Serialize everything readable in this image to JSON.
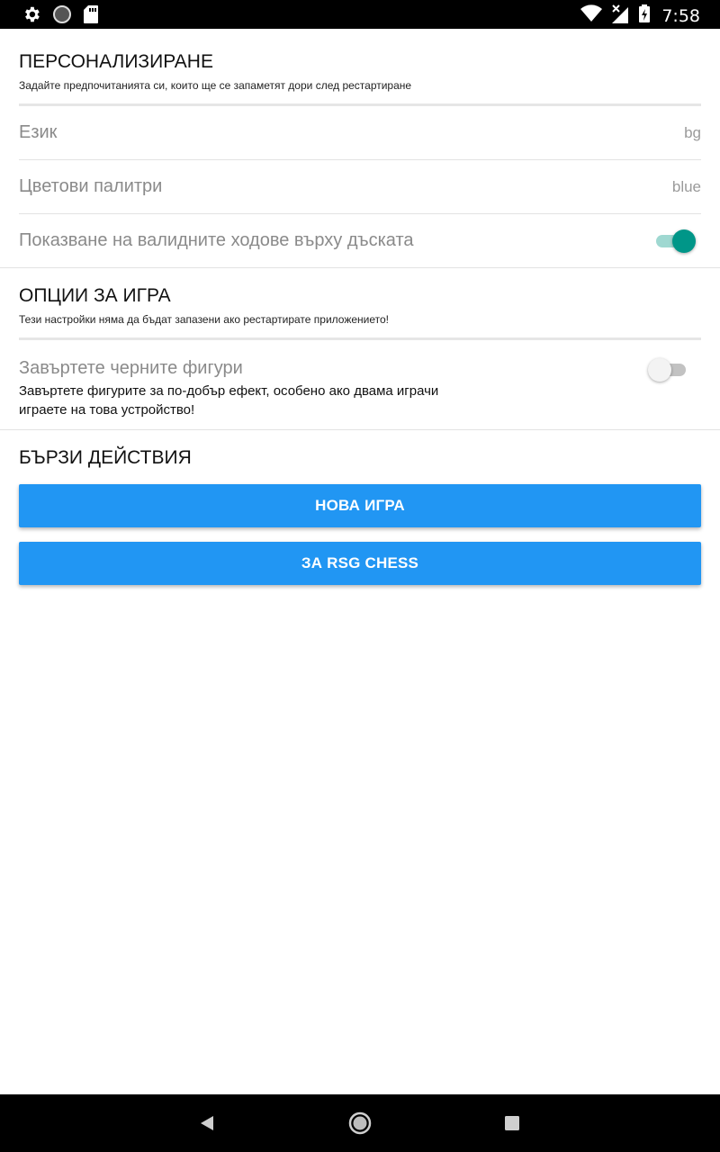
{
  "status_bar": {
    "time": "7:58",
    "left_icons": [
      "gear-icon",
      "circle-icon",
      "sd-card-icon"
    ],
    "right_icons": [
      "wifi-icon",
      "no-signal-icon",
      "battery-charging-icon"
    ]
  },
  "personalization": {
    "title": "ПЕРСОНАЛИЗИРАНЕ",
    "description": "Задайте предпочитанията си, които ще се запаметят дори след рестартиране",
    "language": {
      "label": "Език",
      "value": "bg"
    },
    "palette": {
      "label": "Цветови палитри",
      "value": "blue"
    },
    "valid_moves": {
      "label": "Показване на валидните ходове върху дъската",
      "enabled": true
    }
  },
  "game_options": {
    "title": "ОПЦИИ ЗА ИГРА",
    "description": "Тези настройки няма да бъдат запазени ако рестартирате приложението!",
    "rotate": {
      "label": "Завъртете черните фигури",
      "description": "Завъртете фигурите за по-добър ефект, особено ако двама играчи играете на това устройство!",
      "enabled": false
    }
  },
  "quick_actions": {
    "title": "БЪРЗИ ДЕЙСТВИЯ",
    "new_game_label": "НОВА ИГРА",
    "about_label": "ЗА RSG CHESS"
  },
  "colors": {
    "accent": "#2196f3",
    "toggle_on": "#009688"
  },
  "nav_bar": {
    "icons": [
      "back-icon",
      "home-icon",
      "recents-icon"
    ]
  }
}
